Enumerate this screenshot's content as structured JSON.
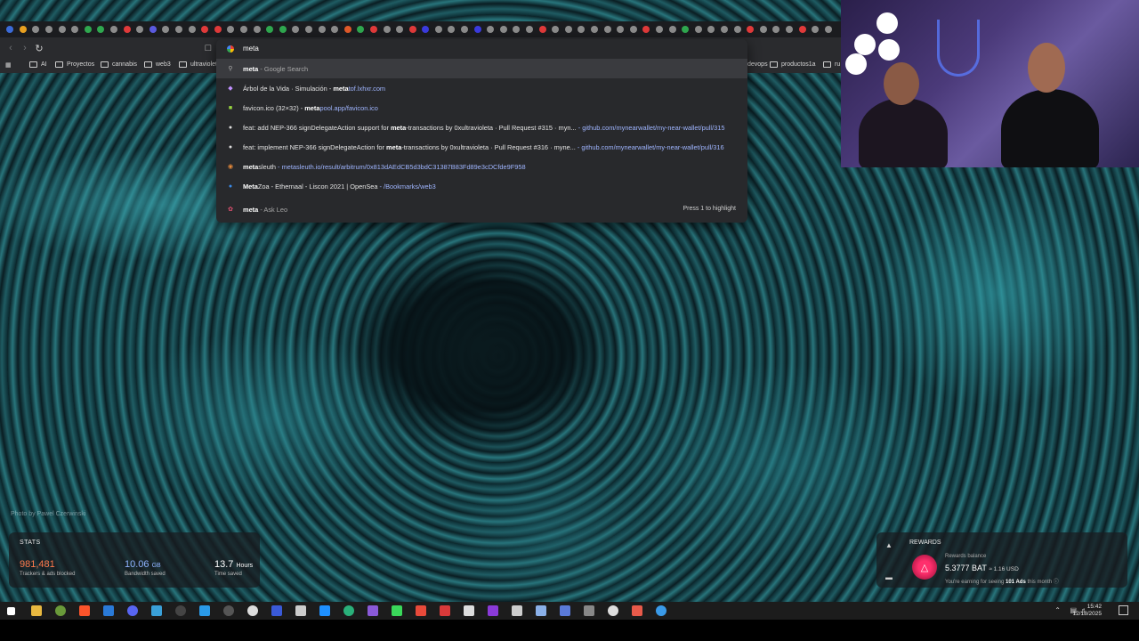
{
  "wallpaper": {
    "credit": "Photo by Pawel Czerwinski"
  },
  "tabs": {
    "favicon_colors": [
      "#3b6bd8",
      "#e8a020",
      "#8c8c8c",
      "#8c8c8c",
      "#8c8c8c",
      "#8c8c8c",
      "#2fa84f",
      "#2fa84f",
      "#8c8c8c",
      "#e03a3a",
      "#8c8c8c",
      "#5a5adf",
      "#8c8c8c",
      "#8c8c8c",
      "#8c8c8c",
      "#e03a3a",
      "#e03a3a",
      "#8c8c8c",
      "#8c8c8c",
      "#8c8c8c",
      "#2fa84f",
      "#2fa84f",
      "#8c8c8c",
      "#8c8c8c",
      "#8c8c8c",
      "#8c8c8c",
      "#e05a2a",
      "#2fa84f",
      "#e03a3a",
      "#8c8c8c",
      "#8c8c8c",
      "#e03a3a",
      "#3b3bdf",
      "#8c8c8c",
      "#8c8c8c",
      "#8c8c8c",
      "#3b3bdf",
      "#8c8c8c",
      "#8c8c8c",
      "#8c8c8c",
      "#8c8c8c",
      "#e03a3a",
      "#8c8c8c",
      "#8c8c8c",
      "#8c8c8c",
      "#8c8c8c",
      "#8c8c8c",
      "#8c8c8c",
      "#8c8c8c",
      "#e03a3a",
      "#8c8c8c",
      "#8c8c8c",
      "#2fa84f",
      "#8c8c8c",
      "#8c8c8c",
      "#8c8c8c",
      "#8c8c8c",
      "#e03a3a",
      "#8c8c8c",
      "#8c8c8c",
      "#8c8c8c",
      "#e03a3a",
      "#8c8c8c",
      "#8c8c8c"
    ]
  },
  "toolbar": {
    "back_icon": "back-arrow-icon",
    "forward_icon": "forward-arrow-icon",
    "reload_icon": "reload-icon",
    "bookmark_icon": "bookmark-icon"
  },
  "bookmarks": {
    "items": [
      "AI",
      "Proyectos",
      "cannabis",
      "web3",
      "ultraviolet",
      "devops",
      "productos1a",
      "ru"
    ]
  },
  "omnibox": {
    "input_value": "meta",
    "suggestions": [
      {
        "bold": "meta",
        "rest": " - Google Search",
        "url": ""
      },
      {
        "pre": "Árbol de la Vida · Simulación - ",
        "bold": "meta",
        "rest": "tof.lxhxr.com",
        "url": ""
      },
      {
        "pre": "favicon.ico (32×32) - ",
        "bold": "meta",
        "rest": "pool.app/favicon.ico",
        "url": ""
      },
      {
        "pre": "feat: add NEP-366 signDelegateAction support for ",
        "bold": "meta",
        "rest": "-transactions by 0xultravioleta · Pull Request #315 · myn...",
        "url": " - github.com/mynearwallet/my-near-wallet/pull/315"
      },
      {
        "pre": "feat: implement NEP-366 signDelegateAction for ",
        "bold": "meta",
        "rest": "-transactions by 0xultravioleta · Pull Request #316 · myne...",
        "url": " - github.com/mynearwallet/my-near-wallet/pull/316"
      },
      {
        "pre": "",
        "bold": "meta",
        "rest": "sleuth",
        "url": " - metasleuth.io/result/arbitrum/0x813dAEdCB5d3bdC31387B83Fd89e3cDCfde9F958"
      },
      {
        "pre": "",
        "bold": "Meta",
        "rest": "Zoa - Ethernaal - Liscon 2021 | OpenSea",
        "url": " - /Bookmarks/web3"
      },
      {
        "pre": "",
        "bold": "meta",
        "rest": "",
        "url": " - Ask Leo"
      }
    ],
    "hint": "Press 1 to highlight"
  },
  "stats": {
    "title": "STATS",
    "trackers_value": "981,481",
    "trackers_label": "Trackers & ads blocked",
    "bandwidth_value": "10.06",
    "bandwidth_unit": "GB",
    "bandwidth_label": "Bandwidth saved",
    "time_value": "13.7",
    "time_unit": "Hours",
    "time_label": "Time saved",
    "accent": "#ff7a4d",
    "blue": "#8fb2ff"
  },
  "rewards": {
    "title": "REWARDS",
    "balance_label": "Rewards balance",
    "balance": "5.3777 BAT",
    "usd": "≈ 1.16 USD",
    "earning_pre": "You're earning for seeing",
    "earning_ads": "101 Ads",
    "earning_post": "this month"
  },
  "taskbar": {
    "time": "15:42",
    "date": "12/18/2025"
  }
}
